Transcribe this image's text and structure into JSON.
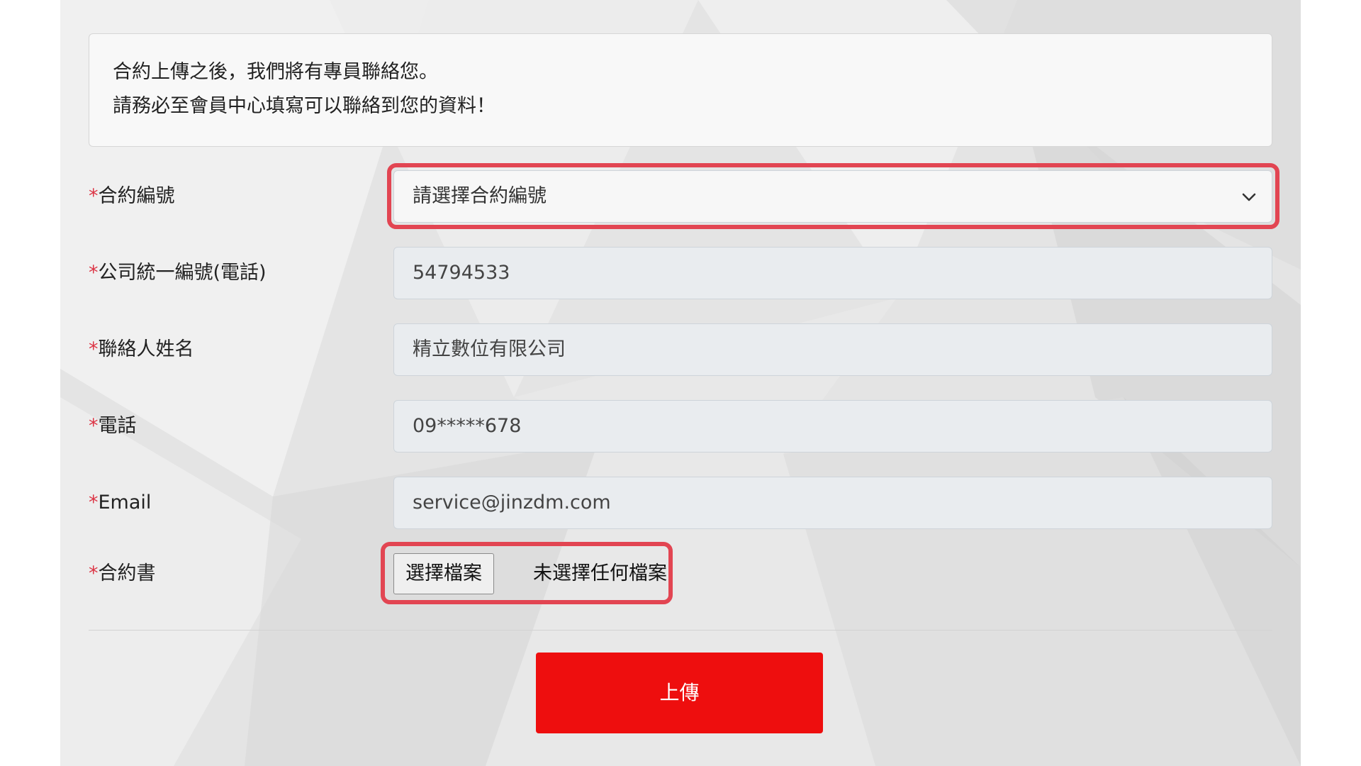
{
  "notice": {
    "line1": "合約上傳之後，我們將有專員聯絡您。",
    "line2": "請務必至會員中心填寫可以聯絡到您的資料！"
  },
  "form": {
    "required_mark": "*",
    "contract_no": {
      "label": "合約編號",
      "placeholder": "請選擇合約編號",
      "icon": "chevron-down-icon"
    },
    "tax_id": {
      "label": "公司統一編號(電話)",
      "value": "54794533"
    },
    "contact_name": {
      "label": "聯絡人姓名",
      "value": "精立數位有限公司"
    },
    "phone": {
      "label": "電話",
      "value": "09*****678"
    },
    "email": {
      "label": "Email",
      "value": "service@jinzdm.com"
    },
    "contract_file": {
      "label": "合約書",
      "button": "選擇檔案",
      "status": "未選擇任何檔案"
    }
  },
  "submit": {
    "label": "上傳"
  },
  "colors": {
    "accent": "#ee0e0e",
    "highlight": "#e24552",
    "required": "#dc3545",
    "panel_bg": "#e4e4e4"
  }
}
